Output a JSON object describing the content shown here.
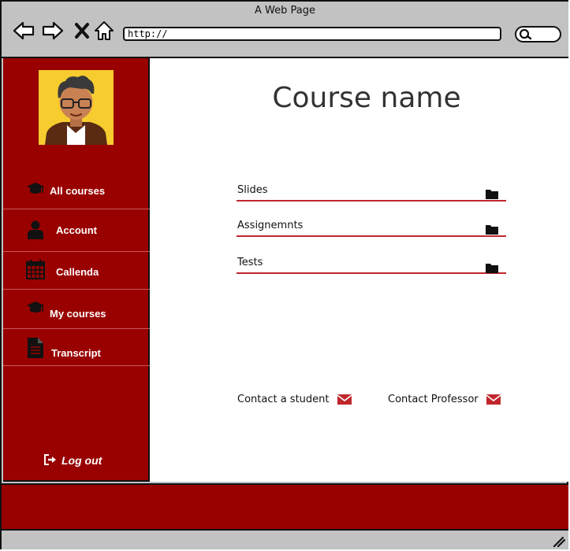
{
  "browser": {
    "window_title": "A Web Page",
    "url": "http://"
  },
  "sidebar": {
    "items": [
      {
        "label": "All courses",
        "icon": "graduation-cap-icon"
      },
      {
        "label": "Account",
        "icon": "user-icon"
      },
      {
        "label": "Callenda",
        "icon": "calendar-icon"
      },
      {
        "label": "My courses",
        "icon": "graduation-cap-icon"
      },
      {
        "label": "Transcript",
        "icon": "document-icon"
      }
    ],
    "logout_label": "Log out"
  },
  "main": {
    "title": "Course name",
    "sections": [
      {
        "label": "Slides"
      },
      {
        "label": "Assignemnts"
      },
      {
        "label": "Tests"
      }
    ],
    "contact_student": "Contact a student",
    "contact_professor": "Contact Professor"
  },
  "colors": {
    "sidebar": "#990000",
    "accent": "#c0272d",
    "chrome": "#c2c2c2",
    "avatar_bg": "#f6cc2f"
  }
}
